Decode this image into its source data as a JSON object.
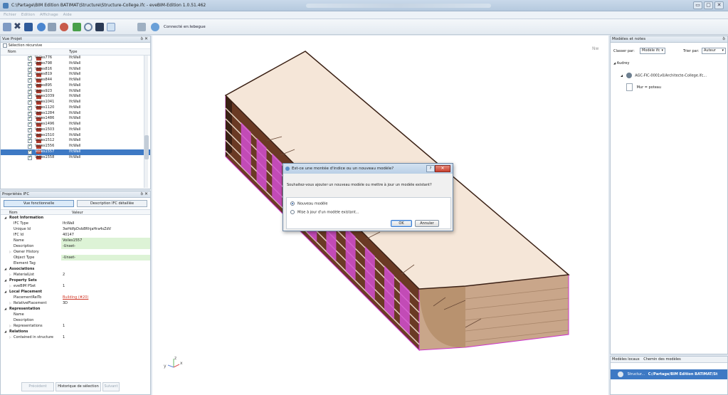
{
  "window": {
    "title": "C:\\Partage\\BIM Edition BATIMAT\\Structure\\Structure-College.ifc - eveBIM-Edition 1.0.51.462",
    "minimize": "▭",
    "maximize": "▢",
    "close": "✕"
  },
  "menu": [
    "Fichier",
    "Edition",
    "Affichage",
    "Aide"
  ],
  "toolbar": {
    "connected_label": "Connecté en:lebegue"
  },
  "project": {
    "title": "Vue Projet",
    "recursive_label": "Sélection récursive",
    "col_name": "Nom",
    "col_type": "Type",
    "rows": [
      {
        "name": "Voiles776",
        "type": "IfcWall"
      },
      {
        "name": "Voiles798",
        "type": "IfcWall"
      },
      {
        "name": "Voiles816",
        "type": "IfcWall"
      },
      {
        "name": "Voiles819",
        "type": "IfcWall"
      },
      {
        "name": "Voiles844",
        "type": "IfcWall"
      },
      {
        "name": "Voiles895",
        "type": "IfcWall"
      },
      {
        "name": "Voiles923",
        "type": "IfcWall"
      },
      {
        "name": "Voiles1039",
        "type": "IfcWall"
      },
      {
        "name": "Voiles1041",
        "type": "IfcWall"
      },
      {
        "name": "Voiles1120",
        "type": "IfcWall"
      },
      {
        "name": "Voiles1284",
        "type": "IfcWall"
      },
      {
        "name": "Voiles1486",
        "type": "IfcWall"
      },
      {
        "name": "Voiles1496",
        "type": "IfcWall"
      },
      {
        "name": "Voiles1503",
        "type": "IfcWall"
      },
      {
        "name": "Voiles1510",
        "type": "IfcWall"
      },
      {
        "name": "Voiles1512",
        "type": "IfcWall"
      },
      {
        "name": "Voiles1556",
        "type": "IfcWall"
      },
      {
        "name": "Voiles1557",
        "type": "IfcWall"
      },
      {
        "name": "Voiles1558",
        "type": "IfcWall"
      }
    ],
    "selected_index": 17
  },
  "properties": {
    "title": "Propriétés IFC",
    "tab_functional": "Vue fonctionnelle",
    "tab_detailed": "Description IFC détaillée",
    "col_name": "Nom",
    "col_value": "Valeur",
    "rows": [
      {
        "kind": "group",
        "key": "Root Information",
        "value": ""
      },
      {
        "kind": "item",
        "key": "IFC Type",
        "value": "IfcWall"
      },
      {
        "kind": "item",
        "key": "Unique Id",
        "value": "3wHdfpDvb8RhjaHra4sZdV"
      },
      {
        "kind": "item",
        "key": "IFC Id",
        "value": "40147"
      },
      {
        "kind": "green",
        "key": "Name",
        "value": "Voiles1557"
      },
      {
        "kind": "green",
        "key": "Description",
        "value": "-Unset-"
      },
      {
        "kind": "coll",
        "key": "Owner History",
        "value": ""
      },
      {
        "kind": "green",
        "key": "Object Type",
        "value": "-Unset-"
      },
      {
        "kind": "item",
        "key": "Element Tag",
        "value": ""
      },
      {
        "kind": "group",
        "key": "Associations",
        "value": ""
      },
      {
        "kind": "coll",
        "key": "MaterialList",
        "value": "2"
      },
      {
        "kind": "group",
        "key": "Property Sets",
        "value": ""
      },
      {
        "kind": "coll",
        "key": "eveBIM PSet",
        "value": "1"
      },
      {
        "kind": "group",
        "key": "Local Placement",
        "value": ""
      },
      {
        "kind": "link",
        "key": "PlacementRelTo",
        "value": "Building (#20)"
      },
      {
        "kind": "coll",
        "key": "RelativePlacement",
        "value": "3D"
      },
      {
        "kind": "group",
        "key": "Representation",
        "value": ""
      },
      {
        "kind": "item",
        "key": "Name",
        "value": ""
      },
      {
        "kind": "item",
        "key": "Description",
        "value": ""
      },
      {
        "kind": "coll",
        "key": "Representations",
        "value": "1"
      },
      {
        "kind": "group",
        "key": "Relations",
        "value": ""
      },
      {
        "kind": "coll",
        "key": "Contained in structure",
        "value": "1"
      }
    ]
  },
  "history": {
    "prev": "Précédent",
    "selection_history": "Historique de sélection",
    "next": "Suivant"
  },
  "viewport": {
    "compass_label": "Nw",
    "axis_z": "z",
    "axis_x": "x",
    "axis_y": "y",
    "colors": {
      "roof": "#f5e6d8",
      "facade": "#d14fd0",
      "wall_dark": "#3a2014",
      "outline": "#cc33cc"
    }
  },
  "dialog": {
    "title": "Est-ce une montée d'indice ou un nouveau modèle?",
    "help": "?",
    "close": "✕",
    "message": "Souhaitez-vous ajouter un nouveau modèle ou mettre à jour un modèle existant?",
    "option_new": "Nouveau modèle",
    "option_update": "Mise à jour d'un modèle existant...",
    "ok": "OK",
    "cancel": "Annuler"
  },
  "models": {
    "title": "Modèles et notes",
    "sort_by_label": "Classer par:",
    "sort_by_value": "Modèle ifc",
    "order_by_label": "Trier par:",
    "order_by_value": "Auteur",
    "author": "Audrey",
    "model_name": "AGC-FIC-0001v0/Architecte-College.ifc...",
    "note": "Mur = poteau",
    "tab_local": "Modèles locaux",
    "tab_path": "Chemin des modèles",
    "local_name": "Structur...",
    "local_path": "C:/Partage/BIM Edition BATIMAT/St"
  }
}
